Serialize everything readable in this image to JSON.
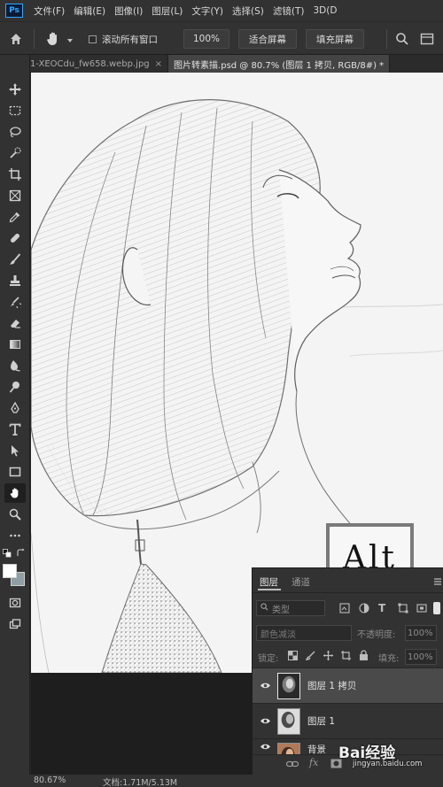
{
  "app": {
    "logo": "Ps"
  },
  "menu": [
    "文件(F)",
    "编辑(E)",
    "图像(I)",
    "图层(L)",
    "文字(Y)",
    "选择(S)",
    "滤镜(T)",
    "3D(D"
  ],
  "options": {
    "scroll_all_label": "滚动所有窗口",
    "zoom_value": "100%",
    "fit_screen_label": "适合屏幕",
    "fill_screen_label": "填充屏幕"
  },
  "tabs": [
    {
      "label": "1-XEOCdu_fw658.webp.jpg",
      "close": "×"
    },
    {
      "label": "图片转素描.psd @ 80.7% (图层 1 拷贝, RGB/8#) *",
      "close": "×"
    }
  ],
  "canvas": {
    "annotation": "Alt"
  },
  "layers_panel": {
    "tab_layers": "图层",
    "tab_channels": "通道",
    "filter_kind": "类型",
    "blend_mode": "颜色减淡",
    "opacity_label": "不透明度:",
    "opacity_value": "100%",
    "lock_label": "锁定:",
    "fill_label": "填充:",
    "fill_value": "100%",
    "layers": [
      {
        "name": "图层 1 拷贝",
        "selected": true
      },
      {
        "name": "图层 1",
        "selected": false
      },
      {
        "name": "背景",
        "selected": false
      }
    ]
  },
  "status": {
    "zoom": "80.67%",
    "doc": "文档:1.71M/5.13M"
  },
  "watermark": {
    "text": "Bai经验",
    "url": "jingyan.baidu.com"
  }
}
